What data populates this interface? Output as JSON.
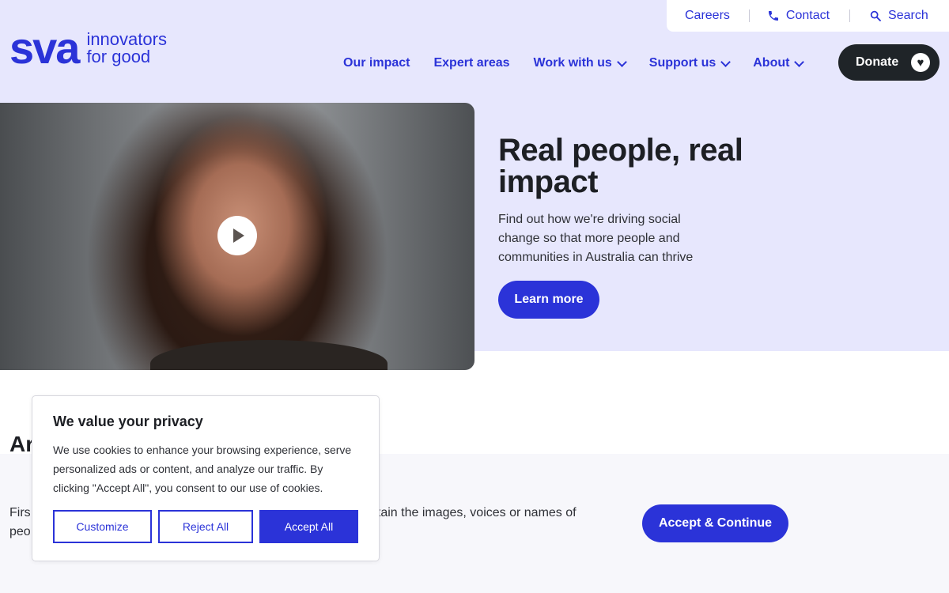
{
  "colors": {
    "brand": "#2b33d8",
    "hero_bg": "#e7e7fd",
    "donate_bg": "#1f2428"
  },
  "utility": {
    "careers": "Careers",
    "contact": "Contact",
    "search": "Search"
  },
  "logo": {
    "mark": "sva",
    "tagline_1": "innovators",
    "tagline_2": "for good"
  },
  "nav": {
    "items": [
      "Our impact",
      "Expert areas",
      "Work with us",
      "Support us",
      "About"
    ],
    "donate": "Donate"
  },
  "hero": {
    "title": "Real people, real impact",
    "subtitle": "Find out how we're driving social change so that more people and communities in Australia can thrive",
    "cta": "Learn more"
  },
  "lower": {
    "heading_fragment": "Ar",
    "notice_line_1_start": "Firs",
    "notice_line_1_end": "ntain the images, voices or names of",
    "notice_line_2_start": "peo",
    "accept_continue": "Accept & Continue"
  },
  "cookie": {
    "title": "We value your privacy",
    "body": "We use cookies to enhance your browsing experience, serve personalized ads or content, and analyze our traffic. By clicking \"Accept All\", you consent to our use of cookies.",
    "customize": "Customize",
    "reject": "Reject All",
    "accept": "Accept All"
  }
}
